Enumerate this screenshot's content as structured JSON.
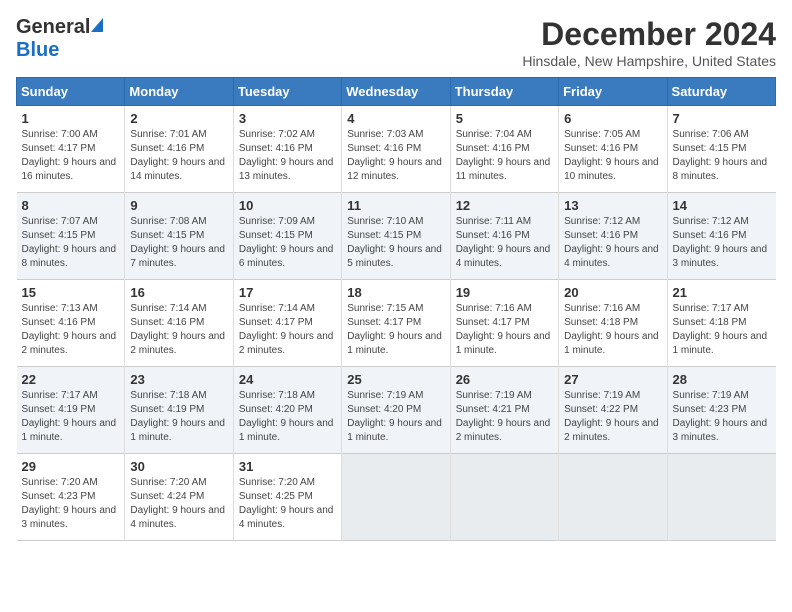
{
  "logo": {
    "general": "General",
    "blue": "Blue"
  },
  "title": "December 2024",
  "subtitle": "Hinsdale, New Hampshire, United States",
  "days_header": [
    "Sunday",
    "Monday",
    "Tuesday",
    "Wednesday",
    "Thursday",
    "Friday",
    "Saturday"
  ],
  "weeks": [
    [
      {
        "num": "1",
        "rise": "7:00 AM",
        "set": "4:17 PM",
        "daylight": "9 hours and 16 minutes."
      },
      {
        "num": "2",
        "rise": "7:01 AM",
        "set": "4:16 PM",
        "daylight": "9 hours and 14 minutes."
      },
      {
        "num": "3",
        "rise": "7:02 AM",
        "set": "4:16 PM",
        "daylight": "9 hours and 13 minutes."
      },
      {
        "num": "4",
        "rise": "7:03 AM",
        "set": "4:16 PM",
        "daylight": "9 hours and 12 minutes."
      },
      {
        "num": "5",
        "rise": "7:04 AM",
        "set": "4:16 PM",
        "daylight": "9 hours and 11 minutes."
      },
      {
        "num": "6",
        "rise": "7:05 AM",
        "set": "4:16 PM",
        "daylight": "9 hours and 10 minutes."
      },
      {
        "num": "7",
        "rise": "7:06 AM",
        "set": "4:15 PM",
        "daylight": "9 hours and 8 minutes."
      }
    ],
    [
      {
        "num": "8",
        "rise": "7:07 AM",
        "set": "4:15 PM",
        "daylight": "9 hours and 8 minutes."
      },
      {
        "num": "9",
        "rise": "7:08 AM",
        "set": "4:15 PM",
        "daylight": "9 hours and 7 minutes."
      },
      {
        "num": "10",
        "rise": "7:09 AM",
        "set": "4:15 PM",
        "daylight": "9 hours and 6 minutes."
      },
      {
        "num": "11",
        "rise": "7:10 AM",
        "set": "4:15 PM",
        "daylight": "9 hours and 5 minutes."
      },
      {
        "num": "12",
        "rise": "7:11 AM",
        "set": "4:16 PM",
        "daylight": "9 hours and 4 minutes."
      },
      {
        "num": "13",
        "rise": "7:12 AM",
        "set": "4:16 PM",
        "daylight": "9 hours and 4 minutes."
      },
      {
        "num": "14",
        "rise": "7:12 AM",
        "set": "4:16 PM",
        "daylight": "9 hours and 3 minutes."
      }
    ],
    [
      {
        "num": "15",
        "rise": "7:13 AM",
        "set": "4:16 PM",
        "daylight": "9 hours and 2 minutes."
      },
      {
        "num": "16",
        "rise": "7:14 AM",
        "set": "4:16 PM",
        "daylight": "9 hours and 2 minutes."
      },
      {
        "num": "17",
        "rise": "7:14 AM",
        "set": "4:17 PM",
        "daylight": "9 hours and 2 minutes."
      },
      {
        "num": "18",
        "rise": "7:15 AM",
        "set": "4:17 PM",
        "daylight": "9 hours and 1 minute."
      },
      {
        "num": "19",
        "rise": "7:16 AM",
        "set": "4:17 PM",
        "daylight": "9 hours and 1 minute."
      },
      {
        "num": "20",
        "rise": "7:16 AM",
        "set": "4:18 PM",
        "daylight": "9 hours and 1 minute."
      },
      {
        "num": "21",
        "rise": "7:17 AM",
        "set": "4:18 PM",
        "daylight": "9 hours and 1 minute."
      }
    ],
    [
      {
        "num": "22",
        "rise": "7:17 AM",
        "set": "4:19 PM",
        "daylight": "9 hours and 1 minute."
      },
      {
        "num": "23",
        "rise": "7:18 AM",
        "set": "4:19 PM",
        "daylight": "9 hours and 1 minute."
      },
      {
        "num": "24",
        "rise": "7:18 AM",
        "set": "4:20 PM",
        "daylight": "9 hours and 1 minute."
      },
      {
        "num": "25",
        "rise": "7:19 AM",
        "set": "4:20 PM",
        "daylight": "9 hours and 1 minute."
      },
      {
        "num": "26",
        "rise": "7:19 AM",
        "set": "4:21 PM",
        "daylight": "9 hours and 2 minutes."
      },
      {
        "num": "27",
        "rise": "7:19 AM",
        "set": "4:22 PM",
        "daylight": "9 hours and 2 minutes."
      },
      {
        "num": "28",
        "rise": "7:19 AM",
        "set": "4:23 PM",
        "daylight": "9 hours and 3 minutes."
      }
    ],
    [
      {
        "num": "29",
        "rise": "7:20 AM",
        "set": "4:23 PM",
        "daylight": "9 hours and 3 minutes."
      },
      {
        "num": "30",
        "rise": "7:20 AM",
        "set": "4:24 PM",
        "daylight": "9 hours and 4 minutes."
      },
      {
        "num": "31",
        "rise": "7:20 AM",
        "set": "4:25 PM",
        "daylight": "9 hours and 4 minutes."
      },
      null,
      null,
      null,
      null
    ]
  ],
  "labels": {
    "sunrise": "Sunrise:",
    "sunset": "Sunset:",
    "daylight": "Daylight:"
  }
}
